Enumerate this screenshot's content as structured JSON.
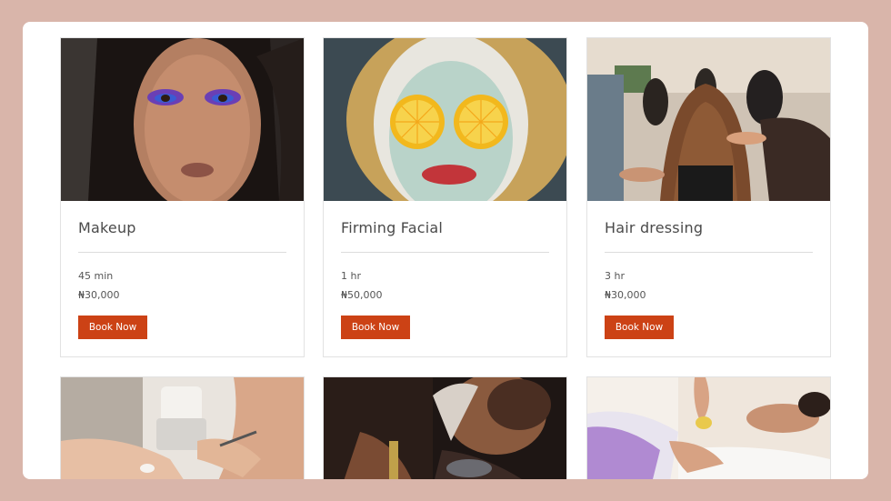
{
  "services": [
    {
      "title": "Makeup",
      "duration": "45 min",
      "price": "₦30,000",
      "button": "Book Now"
    },
    {
      "title": "Firming Facial",
      "duration": "1 hr",
      "price": "₦50,000",
      "button": "Book Now"
    },
    {
      "title": "Hair dressing",
      "duration": "3 hr",
      "price": "₦30,000",
      "button": "Book Now"
    }
  ],
  "colors": {
    "background": "#d9b5aa",
    "button": "#cc4215",
    "card_border": "#e2e2e2"
  }
}
